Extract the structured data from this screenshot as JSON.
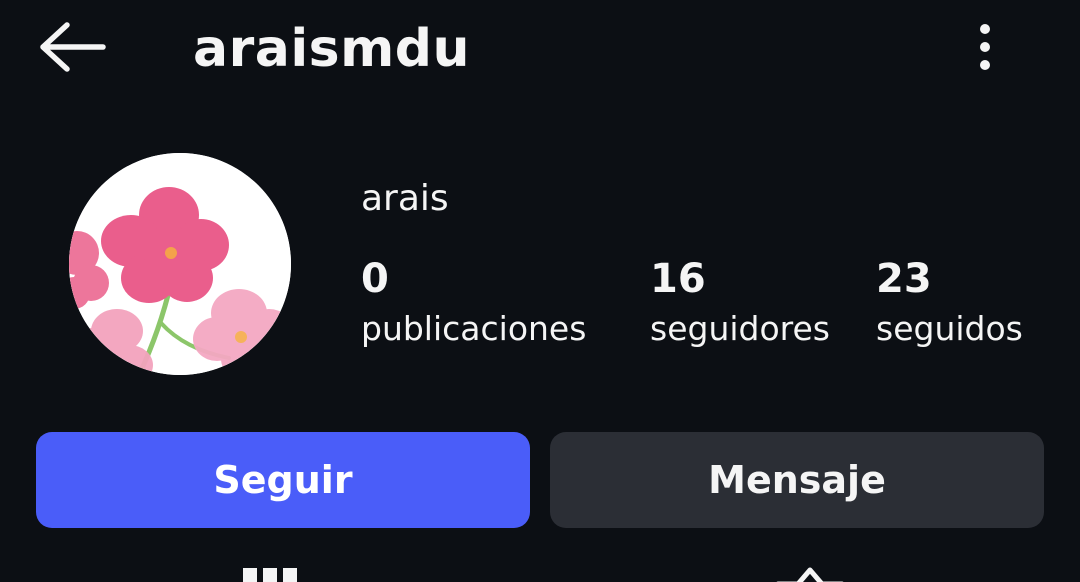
{
  "header": {
    "username": "araismdu"
  },
  "profile": {
    "display_name": "arais",
    "stats": {
      "posts": {
        "value": "0",
        "label": "publicaciones"
      },
      "followers": {
        "value": "16",
        "label": "seguidores"
      },
      "following": {
        "value": "23",
        "label": "seguidos"
      }
    }
  },
  "actions": {
    "follow_label": "Seguir",
    "message_label": "Mensaje"
  },
  "colors": {
    "background": "#0c0f14",
    "follow_button": "#4a5df9",
    "message_button": "#2b2e35",
    "text": "#f5f5f5"
  },
  "icons": {
    "back": "arrow-left-icon",
    "more": "more-vertical-icon",
    "grid": "grid-icon",
    "tagged": "tagged-icon"
  }
}
